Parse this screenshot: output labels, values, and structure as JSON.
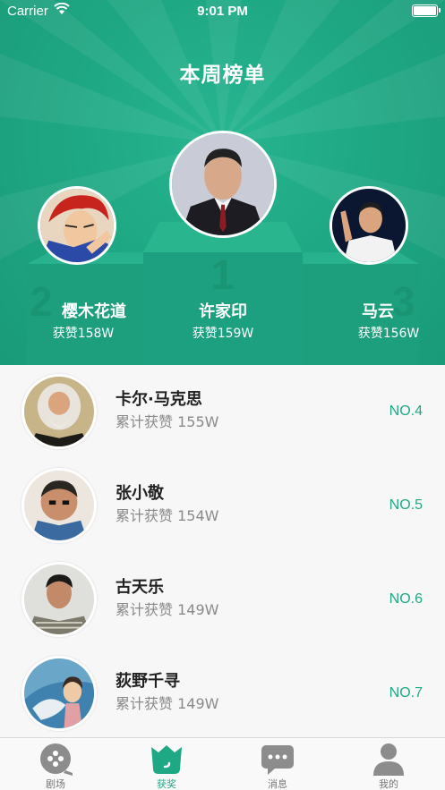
{
  "status_bar": {
    "carrier": "Carrier",
    "time": "9:01 PM"
  },
  "header": {
    "title": "本周榜单"
  },
  "podium": [
    {
      "rank_digit": "2",
      "name": "樱木花道",
      "likes": "获赞158W",
      "avatar": "anime-red-hair"
    },
    {
      "rank_digit": "1",
      "name": "许家印",
      "likes": "获赞159W",
      "avatar": "man-dark-suit"
    },
    {
      "rank_digit": "3",
      "name": "马云",
      "likes": "获赞156W",
      "avatar": "man-white-shirt"
    }
  ],
  "list": [
    {
      "name": "卡尔·马克思",
      "likes_label": "累计获赞",
      "likes": "155W",
      "rank": "NO.4"
    },
    {
      "name": "张小敬",
      "likes_label": "累计获赞",
      "likes": "154W",
      "rank": "NO.5"
    },
    {
      "name": "古天乐",
      "likes_label": "累计获赞",
      "likes": "149W",
      "rank": "NO.6"
    },
    {
      "name": "荻野千寻",
      "likes_label": "累计获赞",
      "likes": "149W",
      "rank": "NO.7"
    }
  ],
  "tabbar": {
    "active_color": "#1fa884",
    "items": [
      {
        "label": "剧场",
        "icon": "theater-icon"
      },
      {
        "label": "获奖",
        "icon": "award-icon"
      },
      {
        "label": "消息",
        "icon": "message-icon"
      },
      {
        "label": "我的",
        "icon": "profile-icon"
      }
    ]
  },
  "colors": {
    "brand": "#1fa884",
    "rank_text": "#1fa884"
  }
}
